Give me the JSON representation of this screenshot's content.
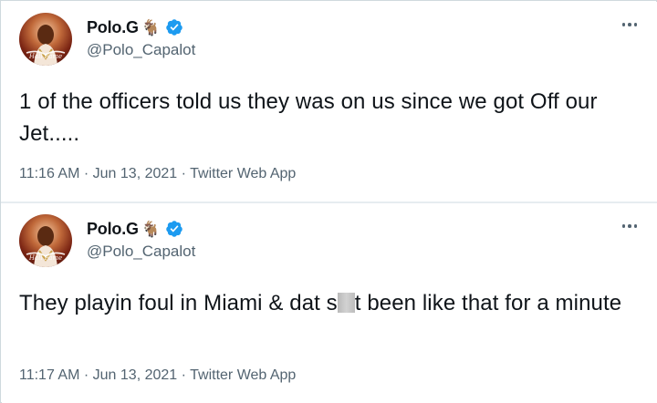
{
  "tweets": [
    {
      "display_name": "Polo.G",
      "name_emoji": "🐐",
      "verified": true,
      "handle": "@Polo_Capalot",
      "text": "1 of the officers told us they was on us since we got Off our Jet.....",
      "time": "11:16 AM",
      "date": "Jun 13, 2021",
      "source": "Twitter Web App",
      "icons": [
        "avatar",
        "goat-emoji",
        "verified-badge-icon",
        "more-options-icon"
      ]
    },
    {
      "display_name": "Polo.G",
      "name_emoji": "🐐",
      "verified": true,
      "handle": "@Polo_Capalot",
      "text_before_censor": "They playin foul in Miami & dat s",
      "text_after_censor": "t been like that for a minute",
      "time": "11:17 AM",
      "date": "Jun 13, 2021",
      "source": "Twitter Web App",
      "icons": [
        "avatar",
        "goat-emoji",
        "verified-badge-icon",
        "more-options-icon"
      ]
    }
  ],
  "separator": "·",
  "colors": {
    "text_primary": "#0f1419",
    "text_secondary": "#536471",
    "verified_blue": "#1d9bf0"
  }
}
